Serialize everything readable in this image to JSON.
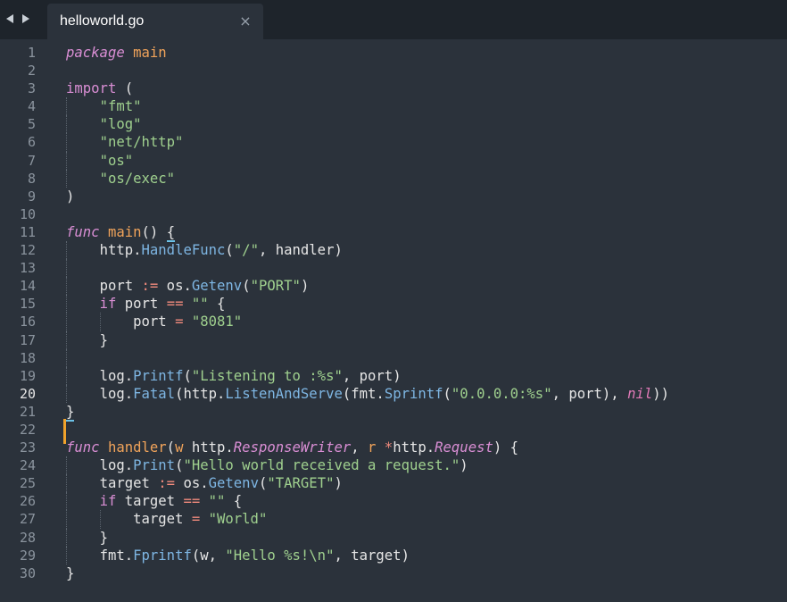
{
  "tab": {
    "title": "helloworld.go",
    "close_glyph": "×"
  },
  "nav": {
    "back_icon": "back-arrow-icon",
    "forward_icon": "forward-arrow-icon"
  },
  "editor": {
    "current_line": 20,
    "colors": {
      "background": "#2b323b",
      "keyword": "#d98ed4",
      "string": "#9fd08e",
      "function_call": "#7eb6e3",
      "operator": "#f28b7d",
      "identifier": "#f0a35a",
      "modified_marker": "#f0a22b"
    },
    "lines": [
      {
        "n": "1",
        "indent": 0,
        "tokens": [
          {
            "c": "kwi",
            "t": "package"
          },
          {
            "c": "plain",
            "t": " "
          },
          {
            "c": "name",
            "t": "main"
          }
        ]
      },
      {
        "n": "2",
        "indent": 0,
        "tokens": []
      },
      {
        "n": "3",
        "indent": 0,
        "tokens": [
          {
            "c": "kw",
            "t": "import"
          },
          {
            "c": "plain",
            "t": " ("
          }
        ]
      },
      {
        "n": "4",
        "indent": 1,
        "tokens": [
          {
            "c": "str",
            "t": "\"fmt\""
          }
        ]
      },
      {
        "n": "5",
        "indent": 1,
        "tokens": [
          {
            "c": "str",
            "t": "\"log\""
          }
        ]
      },
      {
        "n": "6",
        "indent": 1,
        "tokens": [
          {
            "c": "str",
            "t": "\"net/http\""
          }
        ]
      },
      {
        "n": "7",
        "indent": 1,
        "tokens": [
          {
            "c": "str",
            "t": "\"os\""
          }
        ]
      },
      {
        "n": "8",
        "indent": 1,
        "tokens": [
          {
            "c": "str",
            "t": "\"os/exec\""
          }
        ]
      },
      {
        "n": "9",
        "indent": 0,
        "tokens": [
          {
            "c": "plain",
            "t": ")"
          }
        ]
      },
      {
        "n": "10",
        "indent": 0,
        "tokens": []
      },
      {
        "n": "11",
        "indent": 0,
        "tokens": [
          {
            "c": "kwi",
            "t": "func"
          },
          {
            "c": "plain",
            "t": " "
          },
          {
            "c": "name",
            "t": "main"
          },
          {
            "c": "plain",
            "t": "() "
          },
          {
            "c": "brace",
            "t": "{"
          }
        ]
      },
      {
        "n": "12",
        "indent": 1,
        "tokens": [
          {
            "c": "plain",
            "t": "http."
          },
          {
            "c": "call",
            "t": "HandleFunc"
          },
          {
            "c": "plain",
            "t": "("
          },
          {
            "c": "str",
            "t": "\"/\""
          },
          {
            "c": "plain",
            "t": ", handler)"
          }
        ]
      },
      {
        "n": "13",
        "indent": 1,
        "tokens": []
      },
      {
        "n": "14",
        "indent": 1,
        "tokens": [
          {
            "c": "plain",
            "t": "port "
          },
          {
            "c": "op",
            "t": ":="
          },
          {
            "c": "plain",
            "t": " os."
          },
          {
            "c": "call",
            "t": "Getenv"
          },
          {
            "c": "plain",
            "t": "("
          },
          {
            "c": "str",
            "t": "\"PORT\""
          },
          {
            "c": "plain",
            "t": ")"
          }
        ]
      },
      {
        "n": "15",
        "indent": 1,
        "tokens": [
          {
            "c": "kw",
            "t": "if"
          },
          {
            "c": "plain",
            "t": " port "
          },
          {
            "c": "op",
            "t": "=="
          },
          {
            "c": "plain",
            "t": " "
          },
          {
            "c": "str",
            "t": "\"\""
          },
          {
            "c": "plain",
            "t": " {"
          }
        ]
      },
      {
        "n": "16",
        "indent": 2,
        "tokens": [
          {
            "c": "plain",
            "t": "port "
          },
          {
            "c": "op",
            "t": "="
          },
          {
            "c": "plain",
            "t": " "
          },
          {
            "c": "str",
            "t": "\"8081\""
          }
        ]
      },
      {
        "n": "17",
        "indent": 1,
        "tokens": [
          {
            "c": "plain",
            "t": "}"
          }
        ]
      },
      {
        "n": "18",
        "indent": 1,
        "tokens": []
      },
      {
        "n": "19",
        "indent": 1,
        "tokens": [
          {
            "c": "plain",
            "t": "log."
          },
          {
            "c": "call",
            "t": "Printf"
          },
          {
            "c": "plain",
            "t": "("
          },
          {
            "c": "str",
            "t": "\"Listening to :%s\""
          },
          {
            "c": "plain",
            "t": ", port)"
          }
        ]
      },
      {
        "n": "20",
        "indent": 1,
        "tokens": [
          {
            "c": "plain",
            "t": "log."
          },
          {
            "c": "call",
            "t": "Fatal"
          },
          {
            "c": "plain",
            "t": "(http."
          },
          {
            "c": "call",
            "t": "ListenAndServe"
          },
          {
            "c": "plain",
            "t": "(fmt."
          },
          {
            "c": "call",
            "t": "Sprintf"
          },
          {
            "c": "plain",
            "t": "("
          },
          {
            "c": "str",
            "t": "\"0.0.0.0:%s\""
          },
          {
            "c": "plain",
            "t": ", port), "
          },
          {
            "c": "nil",
            "t": "nil"
          },
          {
            "c": "plain",
            "t": "))"
          }
        ]
      },
      {
        "n": "21",
        "indent": 0,
        "tokens": [
          {
            "c": "brace",
            "t": "}"
          }
        ]
      },
      {
        "n": "22",
        "indent": 0,
        "tokens": []
      },
      {
        "n": "23",
        "indent": 0,
        "tokens": [
          {
            "c": "kwi",
            "t": "func"
          },
          {
            "c": "plain",
            "t": " "
          },
          {
            "c": "name",
            "t": "handler"
          },
          {
            "c": "plain",
            "t": "("
          },
          {
            "c": "name",
            "t": "w"
          },
          {
            "c": "plain",
            "t": " http."
          },
          {
            "c": "type",
            "t": "ResponseWriter"
          },
          {
            "c": "plain",
            "t": ", "
          },
          {
            "c": "name",
            "t": "r"
          },
          {
            "c": "plain",
            "t": " "
          },
          {
            "c": "op",
            "t": "*"
          },
          {
            "c": "plain",
            "t": "http."
          },
          {
            "c": "type",
            "t": "Request"
          },
          {
            "c": "plain",
            "t": ") {"
          }
        ]
      },
      {
        "n": "24",
        "indent": 1,
        "tokens": [
          {
            "c": "plain",
            "t": "log."
          },
          {
            "c": "call",
            "t": "Print"
          },
          {
            "c": "plain",
            "t": "("
          },
          {
            "c": "str",
            "t": "\"Hello world received a request.\""
          },
          {
            "c": "plain",
            "t": ")"
          }
        ]
      },
      {
        "n": "25",
        "indent": 1,
        "tokens": [
          {
            "c": "plain",
            "t": "target "
          },
          {
            "c": "op",
            "t": ":="
          },
          {
            "c": "plain",
            "t": " os."
          },
          {
            "c": "call",
            "t": "Getenv"
          },
          {
            "c": "plain",
            "t": "("
          },
          {
            "c": "str",
            "t": "\"TARGET\""
          },
          {
            "c": "plain",
            "t": ")"
          }
        ]
      },
      {
        "n": "26",
        "indent": 1,
        "tokens": [
          {
            "c": "kw",
            "t": "if"
          },
          {
            "c": "plain",
            "t": " target "
          },
          {
            "c": "op",
            "t": "=="
          },
          {
            "c": "plain",
            "t": " "
          },
          {
            "c": "str",
            "t": "\"\""
          },
          {
            "c": "plain",
            "t": " {"
          }
        ]
      },
      {
        "n": "27",
        "indent": 2,
        "tokens": [
          {
            "c": "plain",
            "t": "target "
          },
          {
            "c": "op",
            "t": "="
          },
          {
            "c": "plain",
            "t": " "
          },
          {
            "c": "str",
            "t": "\"World\""
          }
        ]
      },
      {
        "n": "28",
        "indent": 1,
        "tokens": [
          {
            "c": "plain",
            "t": "}"
          }
        ]
      },
      {
        "n": "29",
        "indent": 1,
        "tokens": [
          {
            "c": "plain",
            "t": "fmt."
          },
          {
            "c": "call",
            "t": "Fprintf"
          },
          {
            "c": "plain",
            "t": "(w, "
          },
          {
            "c": "str",
            "t": "\"Hello %s!\\n\""
          },
          {
            "c": "plain",
            "t": ", target)"
          }
        ]
      },
      {
        "n": "30",
        "indent": 0,
        "tokens": [
          {
            "c": "plain",
            "t": "}"
          }
        ]
      }
    ]
  }
}
